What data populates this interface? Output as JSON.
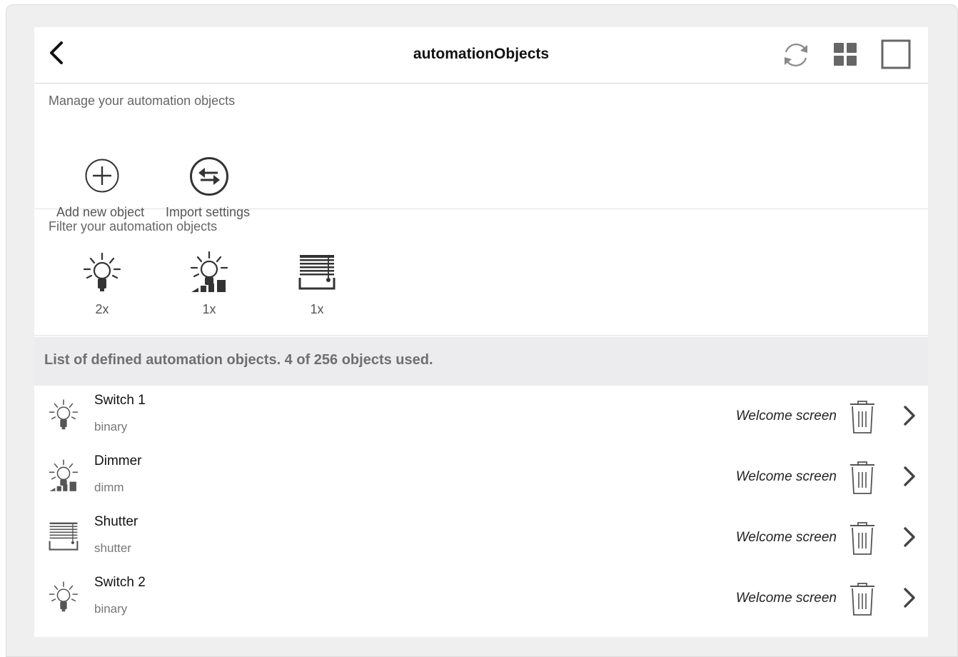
{
  "header": {
    "title": "automationObjects",
    "back_icon": "chevron-left-icon",
    "refresh_icon": "refresh-icon",
    "grid_icon": "grid-icon",
    "window_icon": "window-icon"
  },
  "manage": {
    "label": "Manage your automation objects",
    "actions": [
      {
        "label": "Add new object",
        "icon": "plus-circle-icon"
      },
      {
        "label": "Import settings",
        "icon": "swap-circle-icon"
      }
    ]
  },
  "filter": {
    "label": "Filter your automation objects",
    "items": [
      {
        "icon": "bulb-icon",
        "count": "2x"
      },
      {
        "icon": "dimmer-bulb-icon",
        "count": "1x"
      },
      {
        "icon": "shutter-icon",
        "count": "1x"
      }
    ]
  },
  "list": {
    "header": "List of defined automation objects. 4 of 256 objects used.",
    "rows": [
      {
        "name": "Switch 1",
        "type": "binary",
        "screen": "Welcome screen",
        "icon": "bulb-icon"
      },
      {
        "name": "Dimmer",
        "type": "dimm",
        "screen": "Welcome screen",
        "icon": "dimmer-bulb-icon"
      },
      {
        "name": "Shutter",
        "type": "shutter",
        "screen": "Welcome screen",
        "icon": "shutter-icon"
      },
      {
        "name": "Switch 2",
        "type": "binary",
        "screen": "Welcome screen",
        "icon": "bulb-icon"
      }
    ]
  },
  "colors": {
    "background": "#efefef",
    "panel": "#ffffff",
    "list_header_bg": "#ececef",
    "icon_gray": "#555555"
  }
}
